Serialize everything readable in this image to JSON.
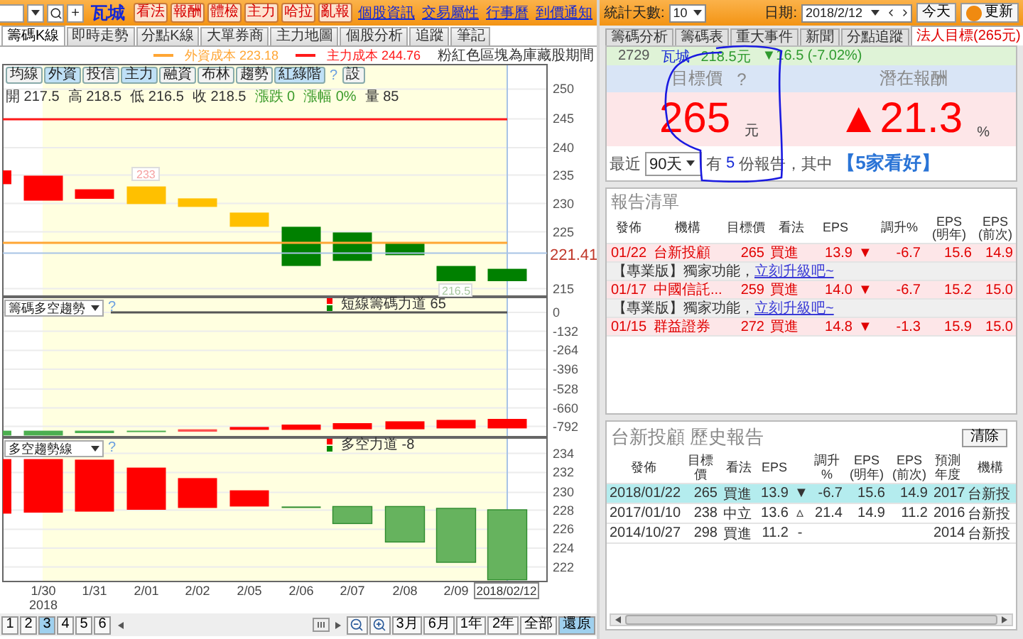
{
  "toolbar": {
    "stock_name": "瓦城",
    "plus": "+",
    "buttons": [
      "看法",
      "報酬",
      "體檢",
      "主力",
      "哈拉",
      "亂報"
    ],
    "links": [
      "個股資訊",
      "交易屬性",
      "行事曆",
      "到價通知"
    ]
  },
  "right_toolbar": {
    "days_label": "統計天數:",
    "days_value": "10",
    "date_label": "日期:",
    "date_value": "2018/2/12",
    "today_button": "今天",
    "refresh_button": "更新"
  },
  "left_tabs": [
    {
      "label": "籌碼K線",
      "selected": true
    },
    {
      "label": "即時走勢",
      "selected": false
    },
    {
      "label": "分點K線",
      "selected": false
    },
    {
      "label": "大單券商",
      "selected": false
    },
    {
      "label": "主力地圖",
      "selected": false
    },
    {
      "label": "個股分析",
      "selected": false
    },
    {
      "label": "追蹤",
      "selected": false
    },
    {
      "label": "筆記",
      "selected": false
    }
  ],
  "tab_note": "粉紅色區塊為庫藏股期間",
  "cost_legend": [
    {
      "label": "外資成本 223.18",
      "color": "#ffa634"
    },
    {
      "label": "主力成本 244.76",
      "color": "#ff1a1a"
    }
  ],
  "price_chart": {
    "buttons": [
      {
        "label": "均線",
        "selected": false
      },
      {
        "label": "外資",
        "selected": true
      },
      {
        "label": "投信",
        "selected": false
      },
      {
        "label": "主力",
        "selected": true
      },
      {
        "label": "融資",
        "selected": false
      },
      {
        "label": "布林",
        "selected": false
      },
      {
        "label": "趨勢",
        "selected": false
      },
      {
        "label": "紅綠階",
        "selected": true
      }
    ],
    "help": "?",
    "settings": "設",
    "quote": [
      {
        "label": "開 217.5",
        "kind": "price"
      },
      {
        "label": "高 218.5",
        "kind": "price"
      },
      {
        "label": "低 216.5",
        "kind": "price"
      },
      {
        "label": "收 218.5",
        "kind": "price"
      },
      {
        "label": "漲跌 0",
        "kind": "change"
      },
      {
        "label": "漲幅 0%",
        "kind": "change"
      },
      {
        "label": "量 85",
        "kind": "price"
      }
    ],
    "y_ticks": [
      "250",
      "245",
      "240",
      "235",
      "230",
      "225",
      "215"
    ],
    "current_price": "221.41",
    "callouts": [
      "233",
      "216.5"
    ]
  },
  "flow_chart": {
    "selector": "籌碼多空趨勢",
    "help": "?",
    "legend": "短線籌碼力道 65",
    "y_ticks": [
      "0",
      "-132",
      "-264",
      "-396",
      "-528",
      "-660",
      "-792"
    ]
  },
  "trend_chart": {
    "selector": "多空趨勢線",
    "help": "?",
    "legend": "多空力道 -8",
    "y_ticks": [
      "234",
      "232",
      "230",
      "228",
      "226",
      "224",
      "222"
    ]
  },
  "x_axis": {
    "labels": [
      {
        "label": "1/30",
        "year": "2018"
      },
      {
        "label": "1/31"
      },
      {
        "label": "2/01"
      },
      {
        "label": "2/02"
      },
      {
        "label": "2/05"
      },
      {
        "label": "2/06"
      },
      {
        "label": "2/07"
      },
      {
        "label": "2/08"
      },
      {
        "label": "2/09"
      }
    ],
    "current": "2018/02/12"
  },
  "pager": [
    {
      "label": "1",
      "selected": false
    },
    {
      "label": "2",
      "selected": false
    },
    {
      "label": "3",
      "selected": true
    },
    {
      "label": "4",
      "selected": false
    },
    {
      "label": "5",
      "selected": false
    },
    {
      "label": "6",
      "selected": false
    }
  ],
  "range_buttons": [
    {
      "label": "3月",
      "selected": false
    },
    {
      "label": "6月",
      "selected": false
    },
    {
      "label": "1年",
      "selected": false
    },
    {
      "label": "2年",
      "selected": false
    },
    {
      "label": "全部",
      "selected": false
    },
    {
      "label": "還原",
      "selected": true
    }
  ],
  "right_tabs": [
    {
      "label": "籌碼分析",
      "selected": false
    },
    {
      "label": "籌碼表",
      "selected": false
    },
    {
      "label": "重大事件",
      "selected": false
    },
    {
      "label": "新聞",
      "selected": false
    },
    {
      "label": "分點追蹤",
      "selected": false
    },
    {
      "label": "法人目標(265元)",
      "selected": true
    }
  ],
  "quote": {
    "code": "2729",
    "name": "瓦城",
    "price": "218.5元",
    "change": "▼16.5 (-7.02%)"
  },
  "target": {
    "label": "目標價",
    "help": "?",
    "value": "265",
    "unit": "元"
  },
  "potential": {
    "label": "潛在報酬",
    "value": "▲21.3",
    "unit": "%"
  },
  "recent": {
    "prefix": "最近",
    "period": "90天",
    "middle": "有",
    "count": "5",
    "suffix": "份報告，其中",
    "highlight": "【5家看好】"
  },
  "report_list": {
    "title": "報告清單",
    "columns": [
      "發佈",
      "機構",
      "目標價",
      "看法",
      "EPS",
      "",
      "調升%",
      "EPS (明年)",
      "EPS (前次)"
    ],
    "rows": [
      {
        "kind": "report",
        "cells": [
          "01/22",
          "台新投顧",
          "265",
          "買進",
          "13.9",
          "▼",
          "-6.7",
          "15.6",
          "14.9"
        ]
      },
      {
        "kind": "promo",
        "text": "【專業版】獨家功能，",
        "link": "立刻升級吧~"
      },
      {
        "kind": "report",
        "cells": [
          "01/17",
          "中國信託...",
          "259",
          "買進",
          "14.0",
          "▼",
          "-6.7",
          "15.2",
          "15.0"
        ]
      },
      {
        "kind": "promo",
        "text": "【專業版】獨家功能，",
        "link": "立刻升級吧~"
      },
      {
        "kind": "report",
        "cells": [
          "01/15",
          "群益證券",
          "272",
          "買進",
          "14.8",
          "▼",
          "-1.3",
          "15.9",
          "15.0"
        ]
      }
    ]
  },
  "history": {
    "title": "台新投顧 歷史報告",
    "clear_button": "清除",
    "columns": [
      "發佈",
      "目標價",
      "看法",
      "EPS",
      "",
      "調升%",
      "EPS (明年)",
      "EPS (前次)",
      "預測年度",
      "機構"
    ],
    "rows": [
      {
        "selected": true,
        "cells": [
          "2018/01/22",
          "265",
          "買進",
          "13.9",
          "▼",
          "-6.7",
          "15.6",
          "14.9",
          "2017",
          "台新投"
        ]
      },
      {
        "selected": false,
        "cells": [
          "2017/01/10",
          "238",
          "中立",
          "13.6",
          "▵",
          "21.4",
          "14.9",
          "11.2",
          "2016",
          "台新投"
        ]
      },
      {
        "selected": false,
        "cells": [
          "2014/10/27",
          "298",
          "買進",
          "11.2",
          "-",
          "",
          "",
          "",
          "2014",
          "台新投"
        ]
      }
    ]
  }
}
